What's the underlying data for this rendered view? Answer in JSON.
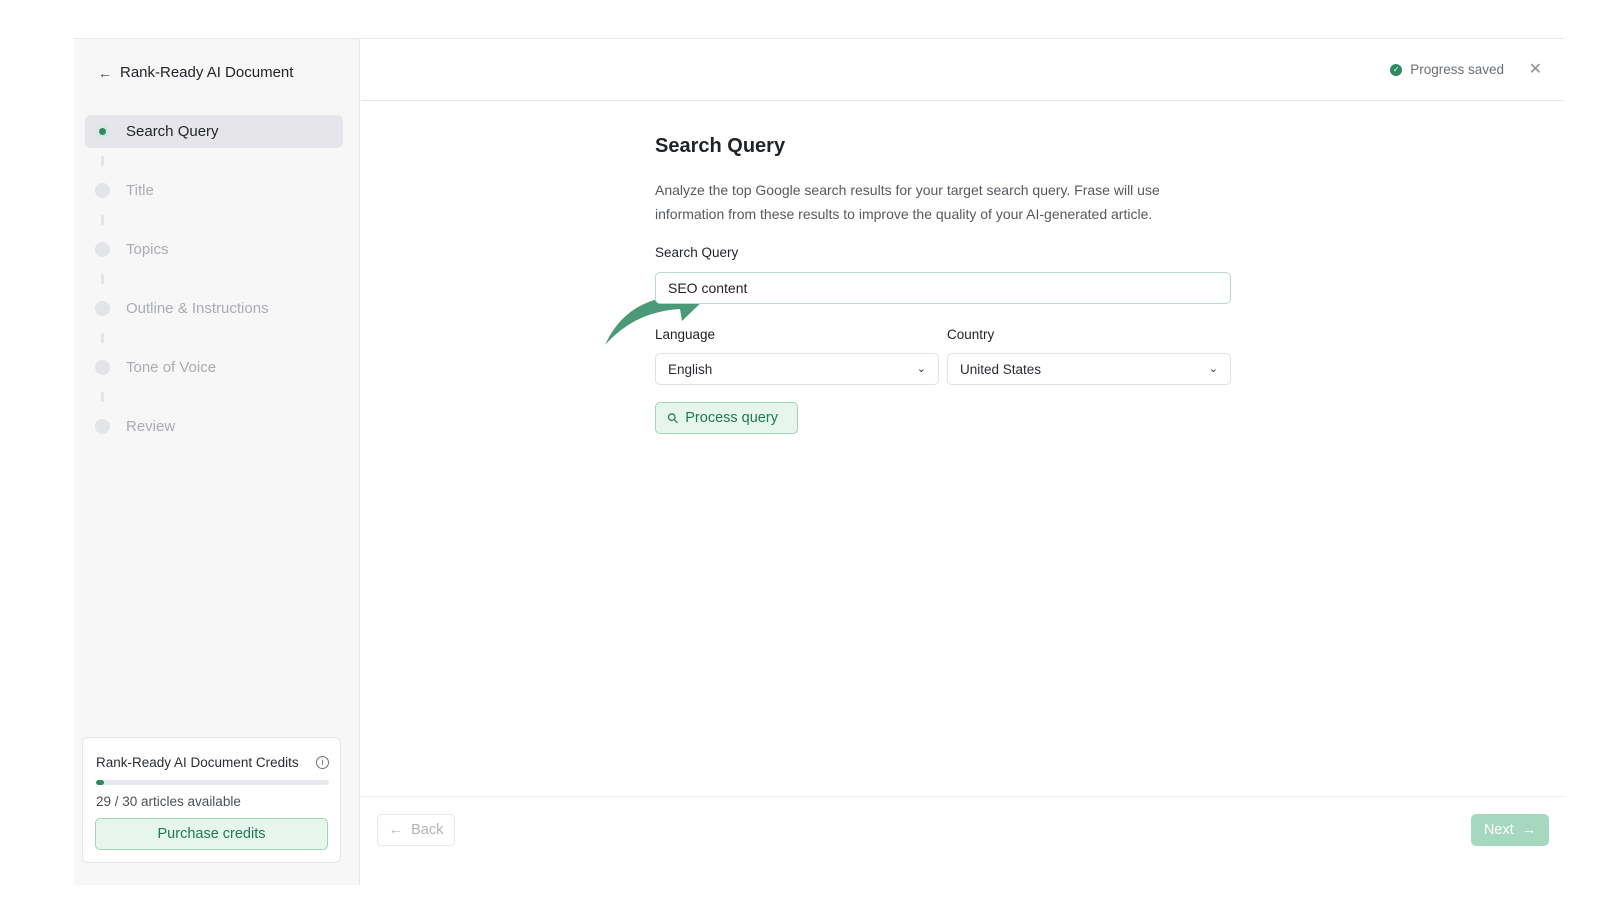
{
  "sidebar": {
    "back_icon": "arrow-left-icon",
    "title": "Rank-Ready AI Document",
    "steps": [
      {
        "label": "Search Query",
        "active": true
      },
      {
        "label": "Title",
        "active": false
      },
      {
        "label": "Topics",
        "active": false
      },
      {
        "label": "Outline & Instructions",
        "active": false
      },
      {
        "label": "Tone of Voice",
        "active": false
      },
      {
        "label": "Review",
        "active": false
      }
    ],
    "credits": {
      "title": "Rank-Ready AI Document Credits",
      "used": 1,
      "total": 30,
      "available_text": "29 / 30 articles available",
      "purchase_label": "Purchase credits"
    }
  },
  "topbar": {
    "status": "Progress saved",
    "status_icon": "check-circle-icon",
    "close_icon": "close-icon"
  },
  "main": {
    "heading": "Search Query",
    "description": "Analyze the top Google search results for your target search query. Frase will use information from these results to improve the quality of your AI-generated article.",
    "query_label": "Search Query",
    "query_value": "SEO content",
    "language_label": "Language",
    "language_value": "English",
    "country_label": "Country",
    "country_value": "United States",
    "process_label": "Process query"
  },
  "footer": {
    "back_label": "Back",
    "next_label": "Next"
  },
  "colors": {
    "accent": "#2f8a63",
    "accent_light": "#e6f6ed",
    "arrow": "#4a9a78"
  }
}
